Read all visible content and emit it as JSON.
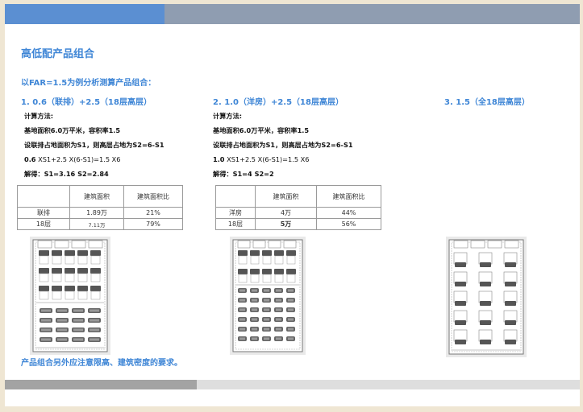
{
  "title": "高低配产品组合",
  "subtitle": "以FAR=1.5为例分析测算产品组合：",
  "options": [
    {
      "heading": "1.  0.6（联排）+2.5（18层高层）",
      "calc_label": "计算方法:",
      "lines": [
        "基地面积6.0万平米，容积率1.5",
        "设联排占地面积为S1，则高层占地为S2=6-S1"
      ],
      "formula_bold": "0.6",
      "formula_rest": " XS1+2.5 X(6-S1)=1.5 X6",
      "solution": "解得：S1=3.16    S2=2.84",
      "table": {
        "headers": [
          "",
          "建筑面积",
          "建筑面积比"
        ],
        "rows": [
          [
            "联排",
            "1.89万",
            "21%"
          ],
          [
            "18层",
            "7.11万",
            "79%"
          ]
        ]
      }
    },
    {
      "heading": "2.   1.0（洋房）+2.5（18层高层）",
      "calc_label": "计算方法:",
      "lines": [
        "基地面积6.0万平米，容积率1.5",
        "设联排占地面积为S1，则高层占地为S2=6-S1"
      ],
      "formula_bold": "1.0",
      "formula_rest": " XS1+2.5 X(6-S1)=1.5 X6",
      "solution": "解得：S1=4    S2=2",
      "table": {
        "headers": [
          "",
          "建筑面积",
          "建筑面积比"
        ],
        "rows": [
          [
            "洋房",
            "4万",
            "44%"
          ],
          [
            "18层",
            "5万",
            "56%"
          ]
        ]
      }
    },
    {
      "heading": "3.   1.5（全18层高层）"
    }
  ],
  "note": "产品组合另外应注意限高、建筑密度的要求。"
}
